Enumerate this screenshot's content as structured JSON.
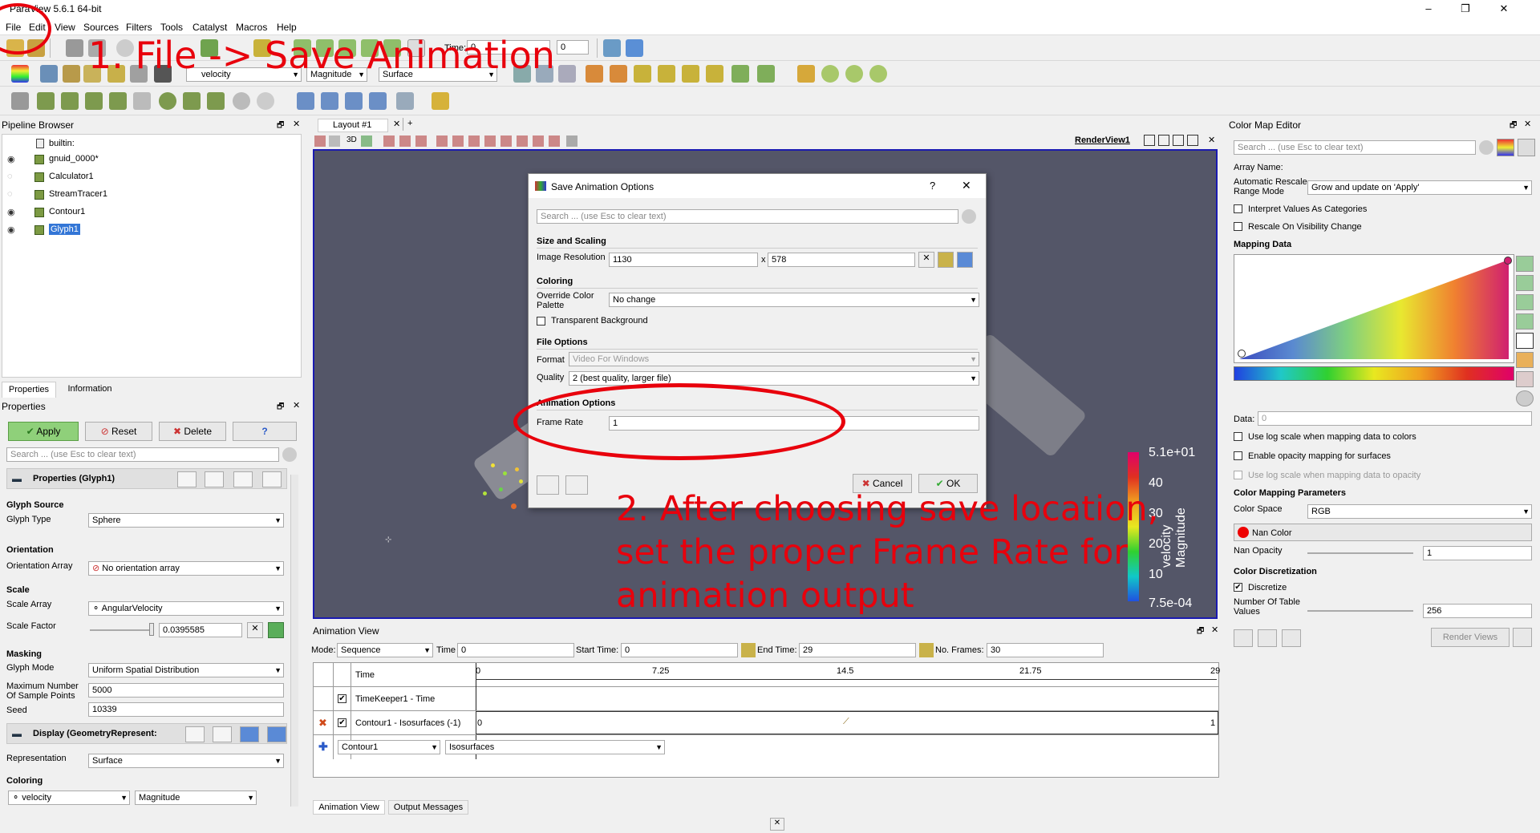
{
  "window": {
    "title": "ParaView 5.6.1 64-bit",
    "min": "–",
    "max": "❐",
    "close": "✕"
  },
  "menu": [
    "File",
    "Edit",
    "View",
    "Sources",
    "Filters",
    "Tools",
    "Catalyst",
    "Macros",
    "Help"
  ],
  "toolbar": {
    "time_label": "Time:",
    "time_value": "0",
    "time_index": "0",
    "color_by": "velocity",
    "component": "Magnitude",
    "representation": "Surface"
  },
  "pipeline": {
    "title": "Pipeline Browser",
    "root": "builtin:",
    "items": [
      {
        "label": "gnuid_0000*",
        "visible": true
      },
      {
        "label": "Calculator1",
        "visible": false
      },
      {
        "label": "StreamTracer1",
        "visible": false
      },
      {
        "label": "Contour1",
        "visible": true
      },
      {
        "label": "Glyph1",
        "visible": true,
        "selected": true
      }
    ]
  },
  "props_tabs": [
    "Properties",
    "Information"
  ],
  "properties": {
    "title": "Properties",
    "apply": "Apply",
    "reset": "Reset",
    "delete": "Delete",
    "help": "?",
    "search_placeholder": "Search ... (use Esc to clear text)",
    "group_title": "Properties (Glyph1)",
    "glyph_source": "Glyph Source",
    "glyph_type_label": "Glyph Type",
    "glyph_type": "Sphere",
    "orientation": "Orientation",
    "orientation_array_label": "Orientation Array",
    "orientation_array": "No orientation array",
    "scale": "Scale",
    "scale_array_label": "Scale Array",
    "scale_array": "AngularVelocity",
    "scale_factor_label": "Scale Factor",
    "scale_factor": "0.0395585",
    "masking": "Masking",
    "glyph_mode_label": "Glyph Mode",
    "glyph_mode": "Uniform Spatial Distribution",
    "max_points_label": "Maximum Number Of Sample Points",
    "max_points": "5000",
    "seed_label": "Seed",
    "seed": "10339",
    "display_title": "Display (GeometryRepresent:",
    "representation_label": "Representation",
    "representation": "Surface",
    "coloring": "Coloring",
    "coloring_array": "velocity",
    "coloring_component": "Magnitude"
  },
  "layout": {
    "tab": "Layout #1",
    "add": "+",
    "view_name": "RenderView1"
  },
  "legend": {
    "title": "velocity Magnitude",
    "ticks": [
      "5.1e+01",
      "40",
      "30",
      "20",
      "10",
      "7.5e-04"
    ]
  },
  "dialog": {
    "title": "Save Animation Options",
    "help": "?",
    "close": "✕",
    "search_placeholder": "Search ... (use Esc to clear text)",
    "size_section": "Size and Scaling",
    "image_res_label": "Image Resolution",
    "res_w": "1130",
    "res_x": "x",
    "res_h": "578",
    "coloring_section": "Coloring",
    "palette_label": "Override Color Palette",
    "palette": "No change",
    "transparent_bg": "Transparent Background",
    "file_section": "File Options",
    "format_label": "Format",
    "format": "Video For Windows",
    "quality_label": "Quality",
    "quality": "2 (best quality, larger file)",
    "anim_section": "Animation Options",
    "frame_rate_label": "Frame Rate",
    "frame_rate": "1",
    "cancel": "Cancel",
    "ok": "OK"
  },
  "annotations": {
    "step1": "1. File -> Save Animation",
    "step2_l1": "2. After choosing save location,",
    "step2_l2": "set the proper Frame Rate for",
    "step2_l3": "animation output",
    "color": "#e8000c"
  },
  "animation": {
    "title": "Animation View",
    "mode_label": "Mode:",
    "mode": "Sequence",
    "time_label": "Time",
    "time": "0",
    "start_label": "Start Time:",
    "start": "0",
    "end_label": "End Time:",
    "end": "29",
    "frames_label": "No. Frames:",
    "frames": "30",
    "col_time": "Time",
    "ticks": [
      "0",
      "7.25",
      "14.5",
      "21.75",
      "29"
    ],
    "track1": "TimeKeeper1 - Time",
    "track2": "Contour1 - Isosurfaces (-1)",
    "track2_start": "0",
    "track2_end": "1",
    "add_source": "Contour1",
    "add_prop": "Isosurfaces",
    "tabs": [
      "Animation View",
      "Output Messages"
    ]
  },
  "colormap": {
    "title": "Color Map Editor",
    "search_placeholder": "Search ... (use Esc to clear text)",
    "array_name_label": "Array Name:",
    "auto_rescale_label": "Automatic Rescale Range Mode",
    "auto_rescale": "Grow and update on 'Apply'",
    "interpret_categories": "Interpret Values As Categories",
    "rescale_visibility": "Rescale On Visibility Change",
    "mapping_data": "Mapping Data",
    "data_label": "Data:",
    "data_value": "0",
    "log_scale": "Use log scale when mapping data to colors",
    "enable_opacity": "Enable opacity mapping for surfaces",
    "log_opacity": "Use log scale when mapping data to opacity",
    "params_section": "Color Mapping Parameters",
    "color_space_label": "Color Space",
    "color_space": "RGB",
    "nan_color": "Nan Color",
    "nan_opacity_label": "Nan Opacity",
    "nan_opacity": "1",
    "discretization": "Color Discretization",
    "discretize": "Discretize",
    "table_values_label": "Number Of Table Values",
    "table_values": "256",
    "render_views": "Render Views"
  }
}
